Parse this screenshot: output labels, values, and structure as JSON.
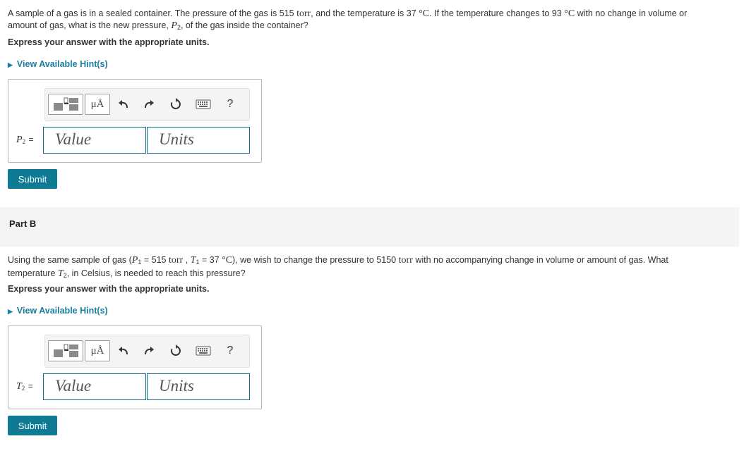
{
  "part_a": {
    "q_line1_a": "A sample of a gas is in a sealed container. The pressure of the gas is 515",
    "q_line1_unit1": "torr",
    "q_line1_b": ", and the temperature is 37",
    "q_line1_unit2": "°C",
    "q_line1_c": ". If the temperature changes to 93",
    "q_line1_unit3": "°C",
    "q_line1_d": "with no change in volume or",
    "q_line2_a": "amount of gas, what is the new pressure,",
    "q_line2_var": "P",
    "q_line2_sub": "2",
    "q_line2_b": ", of the gas inside the container?",
    "instruction": "Express your answer with the appropriate units.",
    "hint": "View Available Hint(s)",
    "answer_label_var": "P",
    "answer_label_sub": "2",
    "answer_label_eq": "=",
    "value_placeholder": "Value",
    "units_placeholder": "Units",
    "submit": "Submit"
  },
  "toolbar": {
    "mu_label": "μÅ",
    "help_label": "?"
  },
  "part_b": {
    "title": "Part B",
    "q_line1_a": "Using the same sample of gas (",
    "p1_var": "P",
    "p1_sub": "1",
    "p1_eq": "= 515",
    "p1_unit": "torr",
    "comma": ",",
    "t1_var": "T",
    "t1_sub": "1",
    "t1_eq": "= 37",
    "t1_unit": "°C",
    "q_line1_b": "), we wish to change the pressure to 5150",
    "q_line1_unit": "torr",
    "q_line1_c": "with no accompanying change in volume or amount of gas. What",
    "q_line2_a": "temperature",
    "q_line2_var": "T",
    "q_line2_sub": "2",
    "q_line2_b": ", in Celsius, is needed to reach this pressure?",
    "instruction": "Express your answer with the appropriate units.",
    "hint": "View Available Hint(s)",
    "answer_label_var": "T",
    "answer_label_sub": "2",
    "answer_label_eq": "=",
    "value_placeholder": "Value",
    "units_placeholder": "Units",
    "submit": "Submit"
  },
  "colors": {
    "accent": "#0e7a94",
    "link": "#1a7ea0",
    "field_border": "#0e6b8a"
  }
}
